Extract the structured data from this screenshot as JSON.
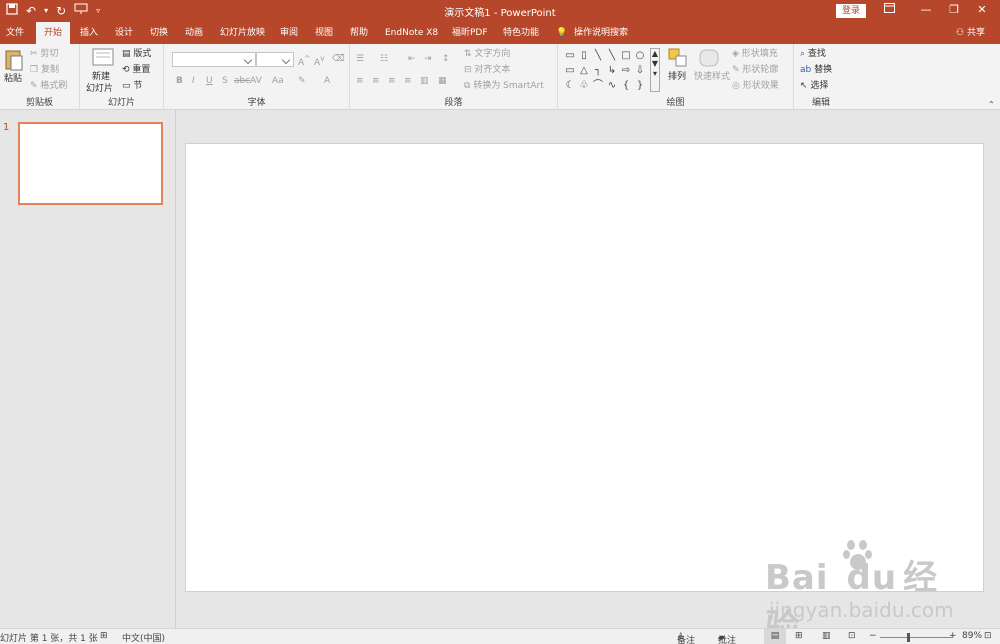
{
  "window": {
    "title": "演示文稿1 - PowerPoint",
    "login_label": "登录",
    "minimize_icon": "minimize-icon",
    "restore_icon": "restore-icon",
    "close_icon": "close-icon",
    "ribbon_display_icon": "ribbon-display-icon"
  },
  "quick_access": {
    "save_icon": "save-icon",
    "undo_icon": "undo-icon",
    "redo_icon": "redo-icon",
    "present_icon": "present-from-start-icon",
    "customize_icon": "customize-qat-icon"
  },
  "tabs": [
    {
      "label": "文件"
    },
    {
      "label": "开始"
    },
    {
      "label": "插入"
    },
    {
      "label": "设计"
    },
    {
      "label": "切换"
    },
    {
      "label": "动画"
    },
    {
      "label": "幻灯片放映"
    },
    {
      "label": "审阅"
    },
    {
      "label": "视图"
    },
    {
      "label": "帮助"
    },
    {
      "label": "EndNote X8"
    },
    {
      "label": "福昕PDF"
    },
    {
      "label": "特色功能"
    },
    {
      "label": "操作说明搜索"
    }
  ],
  "active_tab": "开始",
  "share_label": "共享",
  "ribbon": {
    "clipboard": {
      "group_label": "剪贴板",
      "paste": "粘贴",
      "cut": "剪切",
      "copy": "复制",
      "format_painter": "格式刷"
    },
    "slides": {
      "group_label": "幻灯片",
      "new_slide_line1": "新建",
      "new_slide_line2": "幻灯片",
      "layout": "版式",
      "reset": "重置",
      "section": "节"
    },
    "font": {
      "group_label": "字体",
      "bold": "B",
      "italic": "I",
      "underline": "U",
      "shadow": "S",
      "strike": "abc",
      "spacing": "AV",
      "case": "Aa",
      "color": "A"
    },
    "paragraph": {
      "group_label": "段落",
      "text_direction": "文字方向",
      "align_text": "对齐文本",
      "smartart": "转换为 SmartArt"
    },
    "drawing": {
      "group_label": "绘图",
      "arrange": "排列",
      "quick_styles": "快速样式",
      "shape_fill": "形状填充",
      "shape_outline": "形状轮廓",
      "shape_effects": "形状效果"
    },
    "editing": {
      "group_label": "编辑",
      "find": "查找",
      "replace": "替换",
      "select": "选择"
    }
  },
  "thumbnails": [
    {
      "number": "1"
    }
  ],
  "statusbar": {
    "slide_info": "幻灯片 第 1 张，共 1 张",
    "language": "中文(中国)",
    "notes": "备注",
    "comments": "批注",
    "zoom": "89%",
    "zoom_level": 0.89
  },
  "watermark": {
    "text1": "Bai",
    "text2": "du",
    "text3": "经验",
    "url": "jingyan.baidu.com"
  }
}
